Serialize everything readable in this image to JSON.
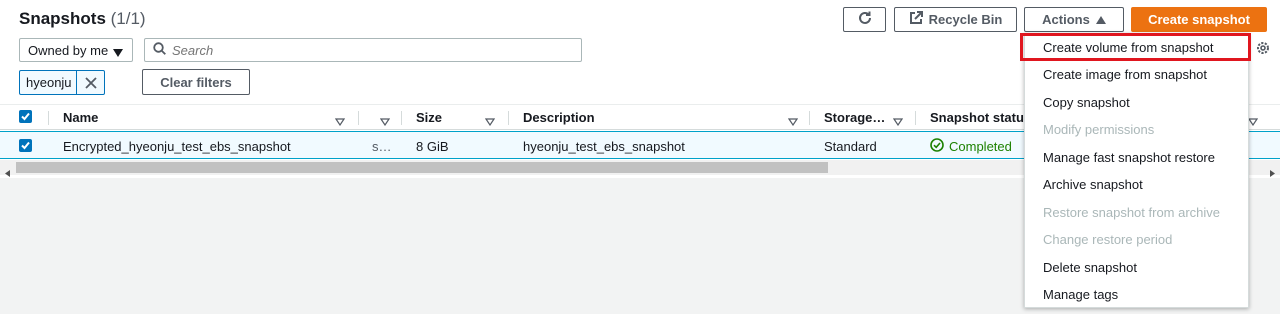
{
  "header": {
    "title": "Snapshots",
    "count": "(1/1)",
    "recycle_bin_label": "Recycle Bin",
    "actions_label": "Actions",
    "create_label": "Create snapshot"
  },
  "filters": {
    "owner_select": "Owned by me",
    "search_placeholder": "Search",
    "token_label": "hyeonju",
    "clear_label": "Clear filters"
  },
  "table": {
    "columns": [
      "Name",
      "Size",
      "Description",
      "Storage…",
      "Snapshot status"
    ],
    "row": {
      "name": "Encrypted_hyeonju_test_ebs_snapshot",
      "id": "s…",
      "size": "8 GiB",
      "description": "hyeonju_test_ebs_snapshot",
      "storage": "Standard",
      "status": "Completed"
    }
  },
  "actions_menu": [
    {
      "label": "Create volume from snapshot",
      "disabled": false
    },
    {
      "label": "Create image from snapshot",
      "disabled": false
    },
    {
      "label": "Copy snapshot",
      "disabled": false
    },
    {
      "label": "Modify permissions",
      "disabled": true
    },
    {
      "label": "Manage fast snapshot restore",
      "disabled": false
    },
    {
      "label": "Archive snapshot",
      "disabled": false
    },
    {
      "label": "Restore snapshot from archive",
      "disabled": true
    },
    {
      "label": "Change restore period",
      "disabled": true
    },
    {
      "label": "Delete snapshot",
      "disabled": false
    },
    {
      "label": "Manage tags",
      "disabled": false
    }
  ],
  "colors": {
    "primary": "#ec7211",
    "selection": "#0073bb",
    "success": "#1d8102",
    "highlight": "#e0161f"
  }
}
